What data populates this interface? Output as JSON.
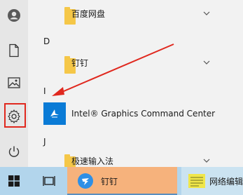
{
  "start_menu": {
    "rail": {
      "items": [
        {
          "name": "user-account",
          "icon": "user-avatar-icon"
        },
        {
          "name": "documents",
          "icon": "document-icon"
        },
        {
          "name": "pictures",
          "icon": "image-icon"
        },
        {
          "name": "settings",
          "icon": "gear-icon",
          "highlighted": true
        },
        {
          "name": "power",
          "icon": "power-icon"
        }
      ]
    },
    "apps": [
      {
        "label": "百度网盘",
        "icon": "folder-icon",
        "expandable": true
      },
      {
        "section": "D"
      },
      {
        "label": "钉钉",
        "icon": "folder-icon",
        "expandable": true
      },
      {
        "section": "I"
      },
      {
        "label": "Intel® Graphics Command Center",
        "icon": "intel-graphics-icon",
        "expandable": false
      },
      {
        "section": "J"
      },
      {
        "label": "极速输入法",
        "icon": "folder-icon",
        "expandable": true
      }
    ]
  },
  "taskbar": {
    "items": [
      {
        "label": "",
        "icon": "windows-start-icon"
      },
      {
        "label": "",
        "icon": "task-view-icon"
      },
      {
        "label": "钉钉",
        "icon": "dingtalk-icon",
        "active": true
      },
      {
        "label": "网络编辑",
        "icon": "editor-icon",
        "active": false
      }
    ]
  },
  "annotation": {
    "type": "arrow",
    "color": "#e0281e",
    "points_to": "Intel® Graphics Command Center"
  },
  "colors": {
    "highlight": "#e0281e",
    "accent_blue": "#0a7bd6",
    "folder": "#f5c748",
    "taskbar": "#b2d5ec",
    "active_app": "#f6b27c"
  }
}
